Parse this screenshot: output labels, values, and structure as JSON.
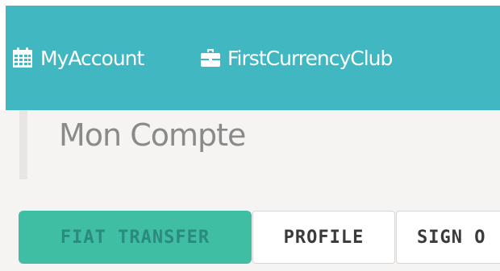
{
  "nav": {
    "links": [
      {
        "label": "MyAccount",
        "icon": "calendar-icon"
      },
      {
        "label": "FirstCurrencyClub",
        "icon": "briefcase-icon"
      }
    ],
    "background_color": "#40b7c1"
  },
  "page": {
    "title": "Mon Compte"
  },
  "tabs": [
    {
      "label": "FIAT TRANSFER",
      "active": true,
      "color": "#3fbea3"
    },
    {
      "label": "PROFILE",
      "active": false
    },
    {
      "label": "SIGN O",
      "active": false
    }
  ]
}
